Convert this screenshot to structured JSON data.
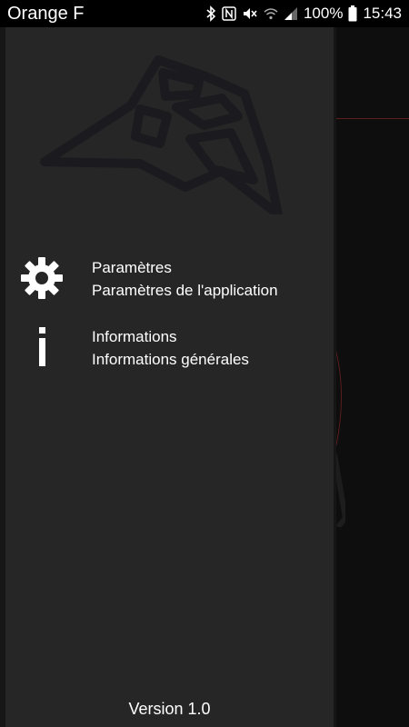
{
  "status_bar": {
    "carrier": "Orange F",
    "battery": "100%",
    "time": "15:43",
    "icons": [
      "bluetooth-icon",
      "nfc-icon",
      "mute-icon",
      "wifi-icon",
      "signal-icon",
      "battery-icon"
    ]
  },
  "drawer": {
    "items": [
      {
        "title": "Paramètres",
        "subtitle": "Paramètres de l'application",
        "icon": "gear-icon"
      },
      {
        "title": "Informations",
        "subtitle": "Informations générales",
        "icon": "info-icon"
      }
    ],
    "version": "Version 1.0"
  },
  "colors": {
    "drawer_bg": "#262626",
    "text": "#ffffff",
    "accent_line": "#5a1e1e"
  }
}
